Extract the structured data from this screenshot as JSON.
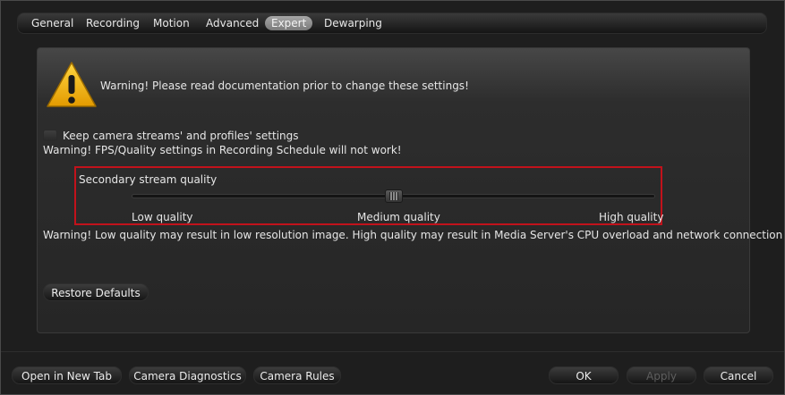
{
  "tabs": [
    {
      "label": "General"
    },
    {
      "label": "Recording"
    },
    {
      "label": "Motion"
    },
    {
      "label": "Advanced"
    },
    {
      "label": "Expert",
      "active": true
    },
    {
      "label": "Dewarping"
    }
  ],
  "header_warning": "Warning! Please read documentation prior to change these settings!",
  "keep_settings": {
    "label": "Keep camera streams' and profiles' settings",
    "checked": false,
    "note": "Warning! FPS/Quality settings in Recording Schedule will not work!"
  },
  "quality": {
    "title": "Secondary stream quality",
    "low": "Low quality",
    "medium": "Medium quality",
    "high": "High quality",
    "value_fraction": 0.5,
    "warning": "Warning! Low quality may result in low resolution image. High quality may result in Media Server's CPU overload and network connection errors."
  },
  "restore_button": "Restore Defaults",
  "bottom_buttons": {
    "open_new_tab": "Open in New Tab",
    "camera_diagnostics": "Camera Diagnostics",
    "camera_rules": "Camera Rules",
    "ok": "OK",
    "apply": "Apply",
    "cancel": "Cancel"
  },
  "colors": {
    "highlight_border": "#c2121b",
    "warning_icon": "#f0b400"
  }
}
